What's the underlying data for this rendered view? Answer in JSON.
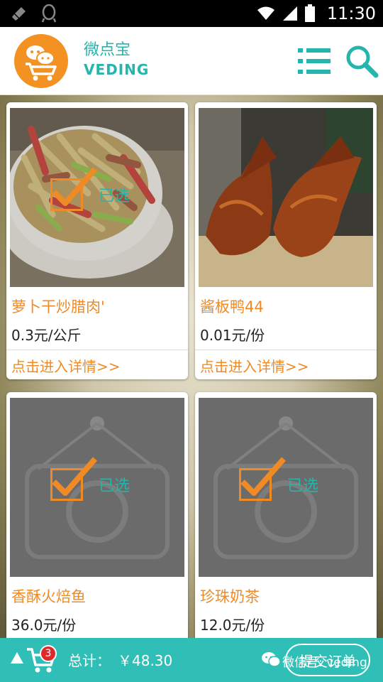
{
  "status_bar": {
    "time": "11:30"
  },
  "header": {
    "app_name_cn": "微点宝",
    "app_name_en": "VEDING"
  },
  "products": [
    {
      "name": "萝卜干炒腊肉'",
      "price": "0.3元/公斤",
      "link": "点击进入详情>>",
      "selected": true,
      "selected_label": "已选"
    },
    {
      "name": "酱板鸭44",
      "price": "0.01元/份",
      "link": "点击进入详情>>",
      "selected": false
    },
    {
      "name": "香酥火焙鱼",
      "price": "36.0元/份",
      "selected": true,
      "selected_label": "已选"
    },
    {
      "name": "珍珠奶茶",
      "price": "12.0元/份",
      "selected": true,
      "selected_label": "已选"
    }
  ],
  "bottom_bar": {
    "cart_count": "3",
    "total_label": "总计：",
    "total_value": "￥48.30",
    "submit_label": "提交订单",
    "watermark": "微信号: veding"
  },
  "colors": {
    "accent_teal": "#26b5ad",
    "accent_orange": "#f08a24",
    "bottom_bar": "#2fbfb7",
    "badge_red": "#e02a2a"
  },
  "icons": [
    "notification-broom-icon",
    "qq-icon",
    "wifi-icon",
    "signal-icon",
    "battery-icon",
    "list-menu-icon",
    "search-icon",
    "up-arrow-icon",
    "cart-icon",
    "wechat-icon",
    "checkbox-icon"
  ]
}
